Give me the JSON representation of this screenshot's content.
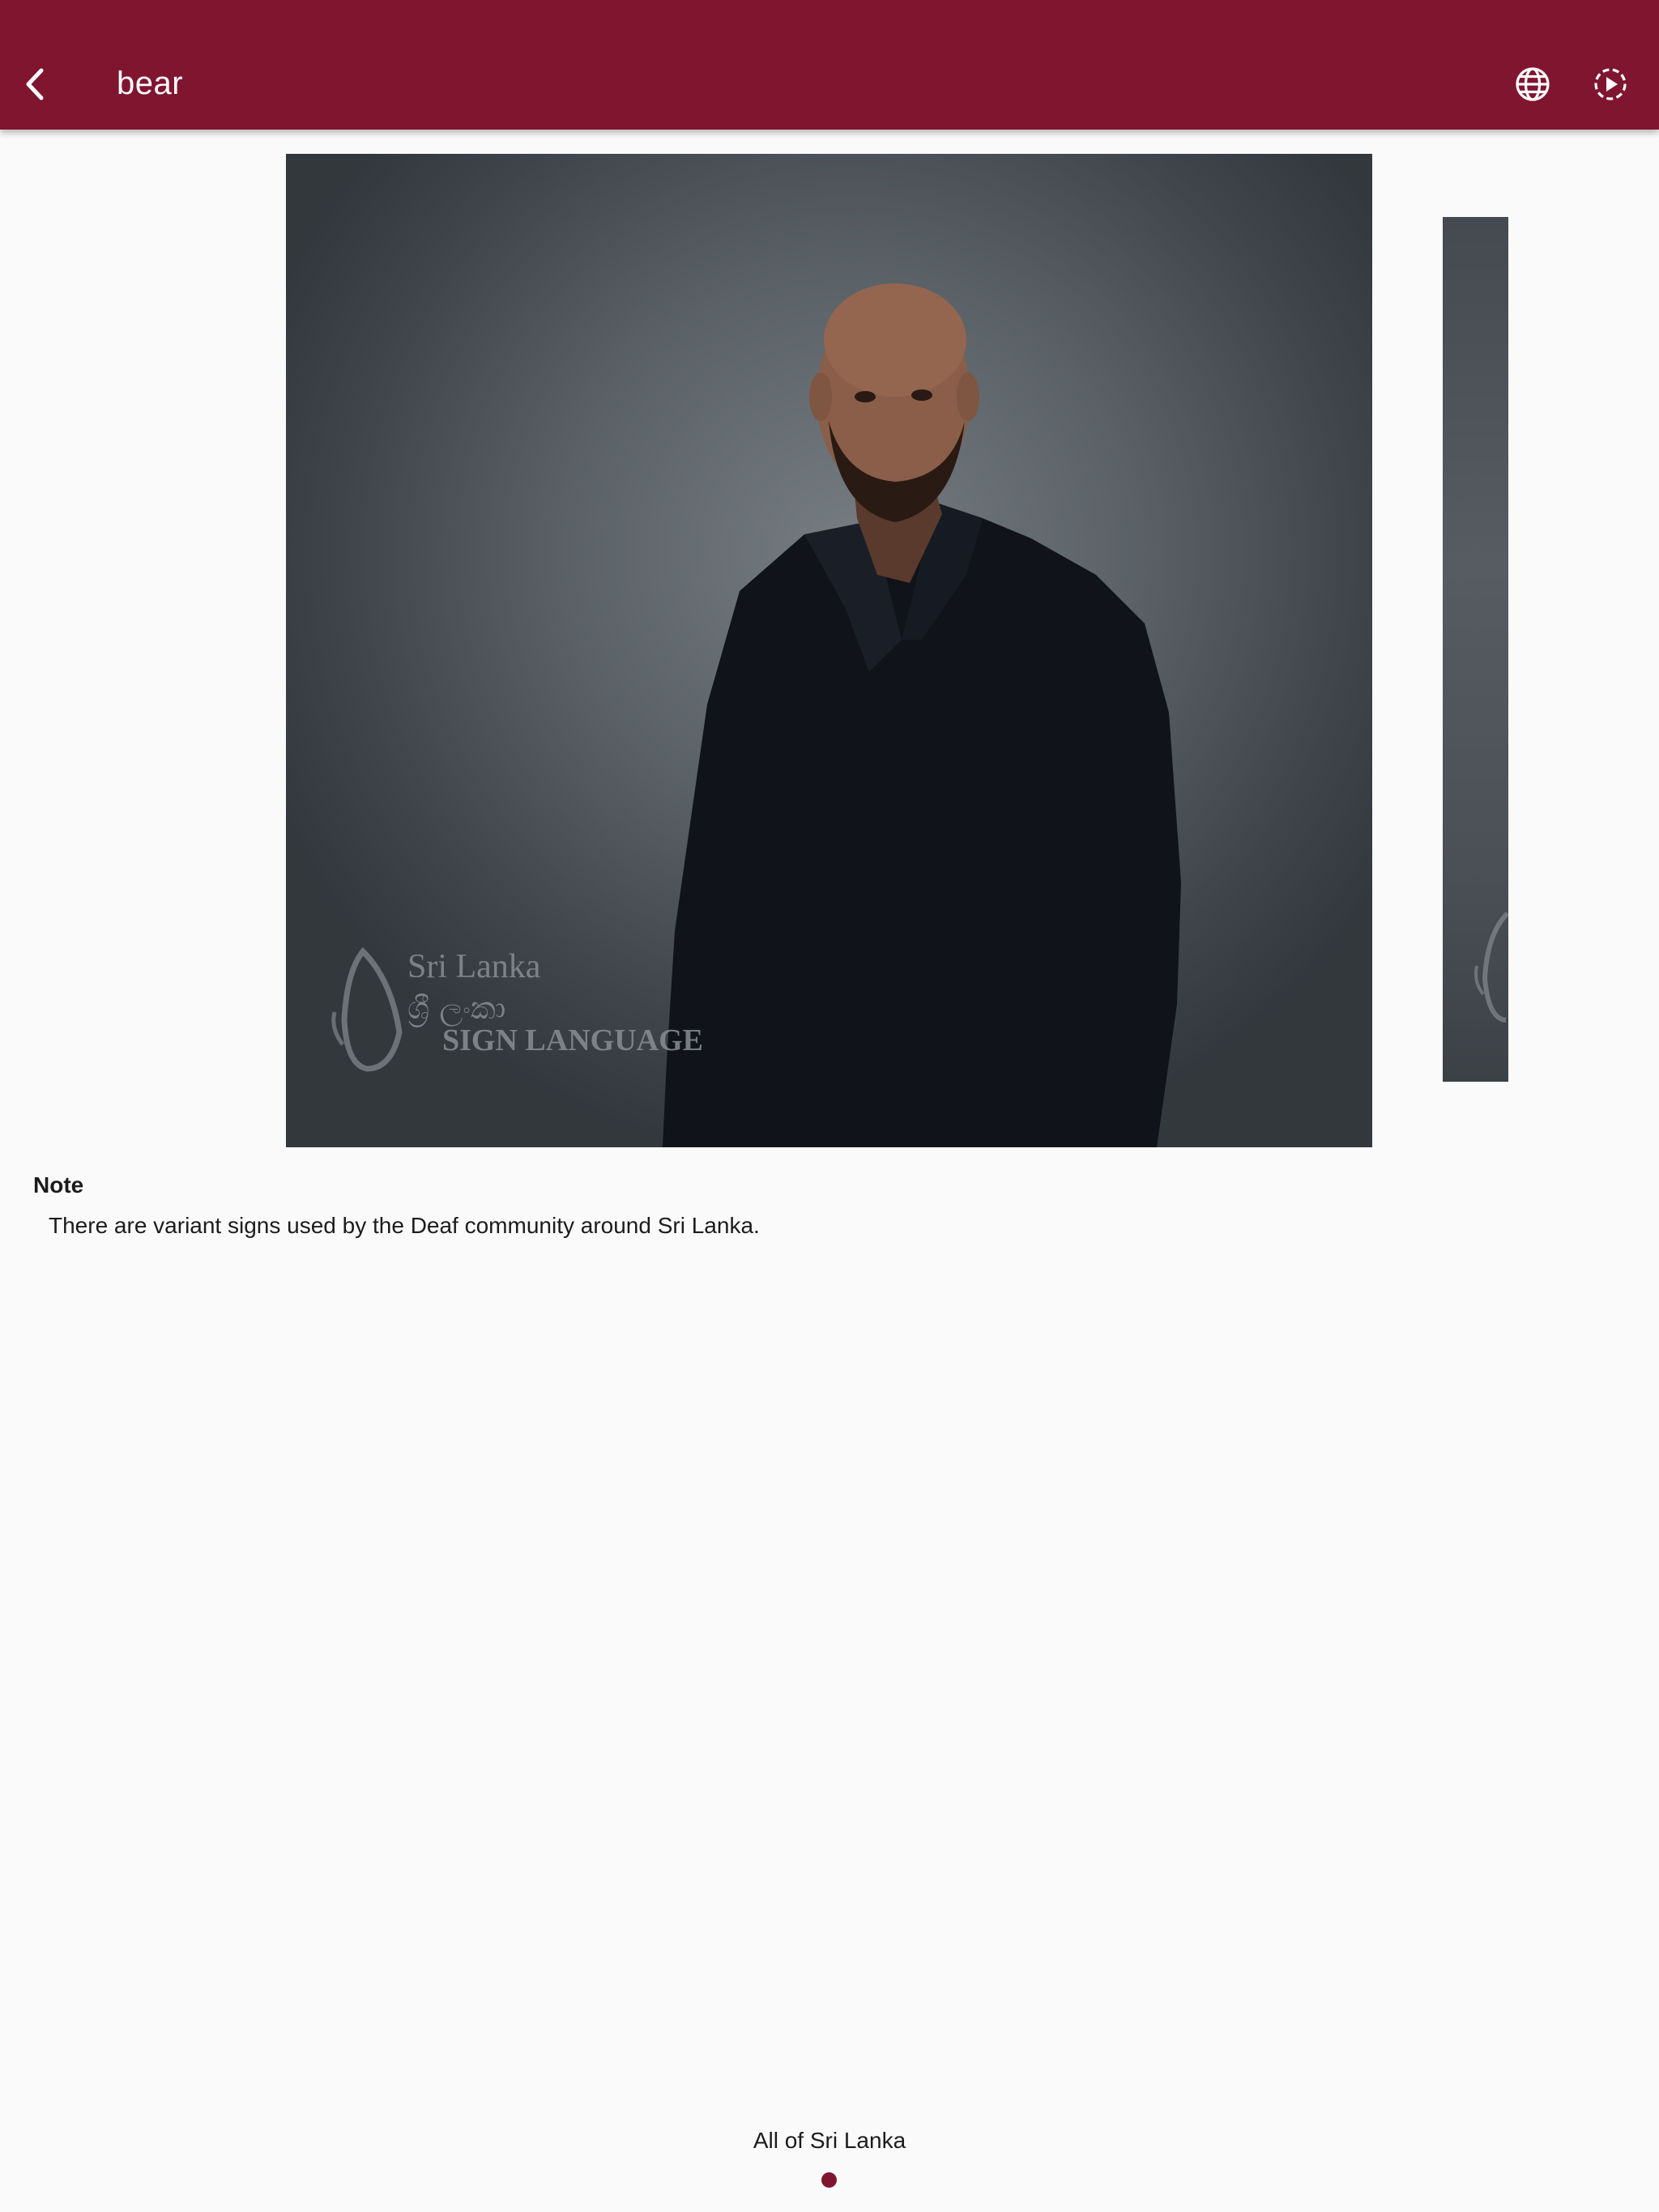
{
  "appbar": {
    "title": "bear",
    "background_color": "#801530",
    "icons": [
      "back-chevron-icon",
      "globe-icon",
      "play-circle-icon"
    ]
  },
  "videos": {
    "watermark_line1": "Sri Lanka",
    "watermark_line2": "ශ්‍රී ලංකා",
    "watermark_line3": "SIGN LANGUAGE"
  },
  "note": {
    "heading": "Note",
    "text": "There are variant signs used by the Deaf community around Sri Lanka."
  },
  "pager": {
    "label": "All of Sri Lanka",
    "dot_color": "#801530"
  }
}
